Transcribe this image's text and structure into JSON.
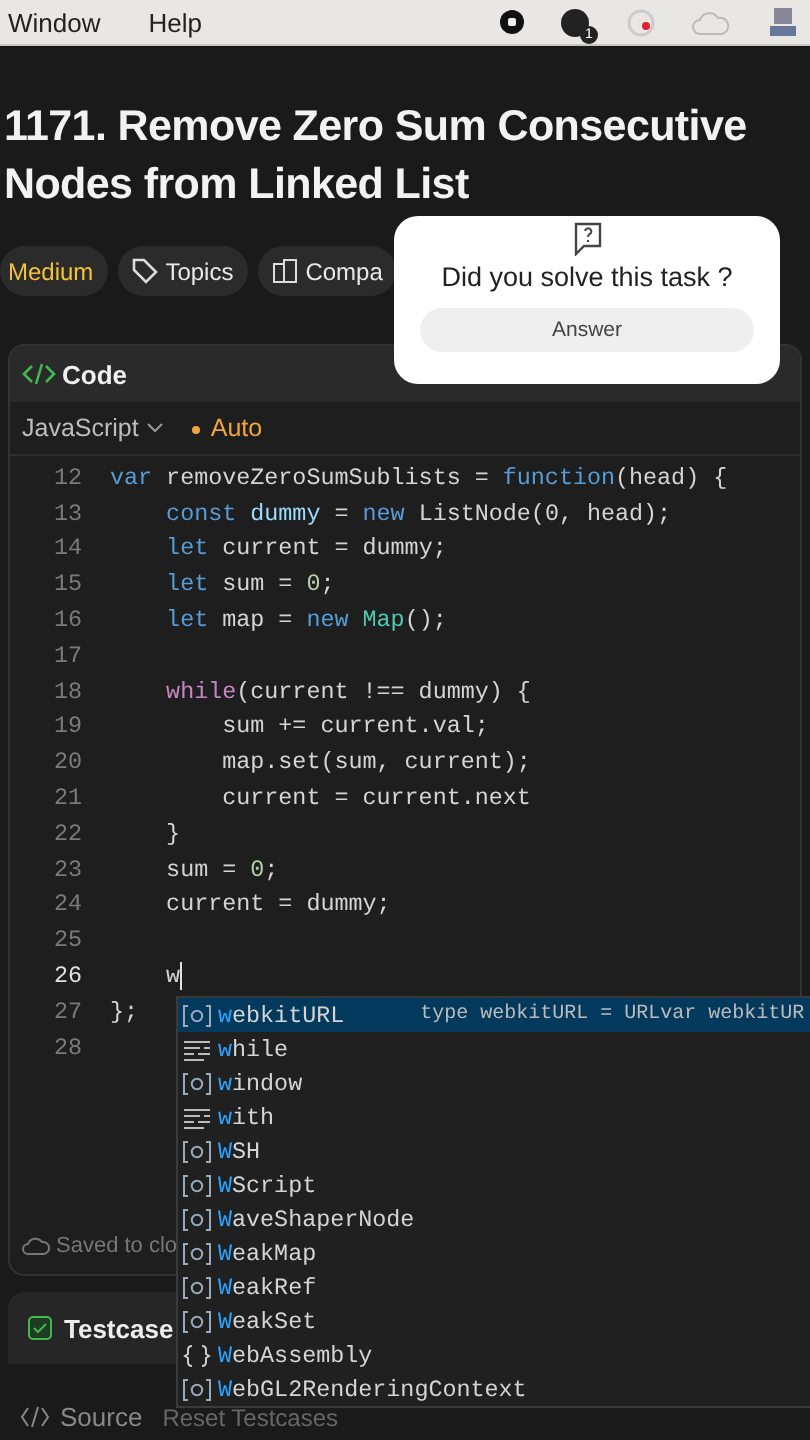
{
  "menu_bar": {
    "items": [
      "Window",
      "Help"
    ],
    "status_icons": [
      {
        "kind": "stop"
      },
      {
        "kind": "badge",
        "badge": "1"
      },
      {
        "kind": "record"
      },
      {
        "kind": "cloud"
      },
      {
        "kind": "computer"
      }
    ]
  },
  "problem": {
    "title": "1171. Remove Zero Sum Consecutive Nodes from Linked List",
    "tags": [
      {
        "kind": "difficulty",
        "label": "Medium"
      },
      {
        "kind": "topics",
        "label": "Topics"
      },
      {
        "kind": "companies",
        "label": "Compa"
      }
    ]
  },
  "survey": {
    "question": "Did you solve this task ?",
    "button": "Answer"
  },
  "code_panel": {
    "title": "Code",
    "language": "JavaScript",
    "mode": "Auto",
    "saved_status": "Saved to clo",
    "lines": [
      {
        "number": "12",
        "current": false,
        "tokens": [
          {
            "kind": "kw",
            "text": "var"
          },
          {
            "kind": "id",
            "text": " removeZeroSumSublists = "
          },
          {
            "kind": "kw",
            "text": "function"
          },
          {
            "kind": "id",
            "text": "(head) {"
          }
        ]
      },
      {
        "number": "13",
        "current": false,
        "tokens": [
          {
            "kind": "kw",
            "text": "    const"
          },
          {
            "kind": "var",
            "text": " dummy"
          },
          {
            "kind": "id",
            "text": " = "
          },
          {
            "kind": "kw",
            "text": "new"
          },
          {
            "kind": "id",
            "text": " ListNode(0, head);"
          }
        ]
      },
      {
        "number": "14",
        "current": false,
        "tokens": [
          {
            "kind": "kw",
            "text": "    let"
          },
          {
            "kind": "id",
            "text": " current = dummy;"
          }
        ]
      },
      {
        "number": "15",
        "current": false,
        "tokens": [
          {
            "kind": "kw",
            "text": "    let"
          },
          {
            "kind": "id",
            "text": " sum = "
          },
          {
            "kind": "num",
            "text": "0"
          },
          {
            "kind": "id",
            "text": ";"
          }
        ]
      },
      {
        "number": "16",
        "current": false,
        "tokens": [
          {
            "kind": "kw",
            "text": "    let"
          },
          {
            "kind": "id",
            "text": " map = "
          },
          {
            "kind": "kw",
            "text": "new"
          },
          {
            "kind": "cls",
            "text": " Map"
          },
          {
            "kind": "id",
            "text": "();"
          }
        ]
      },
      {
        "number": "17",
        "current": false
      },
      {
        "number": "18",
        "current": false,
        "tokens": [
          {
            "kind": "ctl",
            "text": "    while"
          },
          {
            "kind": "id",
            "text": "(current !== dummy) {"
          }
        ]
      },
      {
        "number": "19",
        "current": false,
        "tokens": [
          {
            "kind": "id",
            "text": "        sum += current.val;"
          }
        ]
      },
      {
        "number": "20",
        "current": false,
        "tokens": [
          {
            "kind": "id",
            "text": "        map.set(sum, current);"
          }
        ]
      },
      {
        "number": "21",
        "current": false,
        "tokens": [
          {
            "kind": "id",
            "text": "        current = current.next"
          }
        ]
      },
      {
        "number": "22",
        "current": false,
        "tokens": [
          {
            "kind": "id",
            "text": "    }"
          }
        ]
      },
      {
        "number": "23",
        "current": false,
        "tokens": [
          {
            "kind": "id",
            "text": "    sum = "
          },
          {
            "kind": "num",
            "text": "0"
          },
          {
            "kind": "id",
            "text": ";"
          }
        ]
      },
      {
        "number": "24",
        "current": false,
        "tokens": [
          {
            "kind": "id",
            "text": "    current = dummy;"
          }
        ]
      },
      {
        "number": "25",
        "current": false
      },
      {
        "number": "26",
        "current": true,
        "tokens": [
          {
            "kind": "id",
            "text": "    w"
          }
        ]
      },
      {
        "number": "27",
        "current": false,
        "tokens": [
          {
            "kind": "id",
            "text": "};"
          }
        ]
      },
      {
        "number": "28",
        "current": false
      }
    ]
  },
  "autocomplete": {
    "items": [
      {
        "kind": "variable",
        "label": "webkitURL",
        "detail": "type webkitURL = URLvar webkitUR",
        "selected": true
      },
      {
        "kind": "keyword",
        "label": "while",
        "selected": false
      },
      {
        "kind": "variable",
        "label": "window",
        "selected": false
      },
      {
        "kind": "keyword",
        "label": "with",
        "selected": false
      },
      {
        "kind": "variable",
        "label": "WSH",
        "selected": false
      },
      {
        "kind": "variable",
        "label": "WScript",
        "selected": false
      },
      {
        "kind": "variable",
        "label": "WaveShaperNode",
        "selected": false
      },
      {
        "kind": "variable",
        "label": "WeakMap",
        "selected": false
      },
      {
        "kind": "variable",
        "label": "WeakRef",
        "selected": false
      },
      {
        "kind": "variable",
        "label": "WeakSet",
        "selected": false
      },
      {
        "kind": "module",
        "label": "WebAssembly",
        "selected": false
      },
      {
        "kind": "variable",
        "label": "WebGL2RenderingContext",
        "selected": false
      }
    ]
  },
  "testcase_panel": {
    "title": "Testcase"
  },
  "bottom_bar": {
    "source": "Source",
    "reset": "Reset Testcases"
  }
}
